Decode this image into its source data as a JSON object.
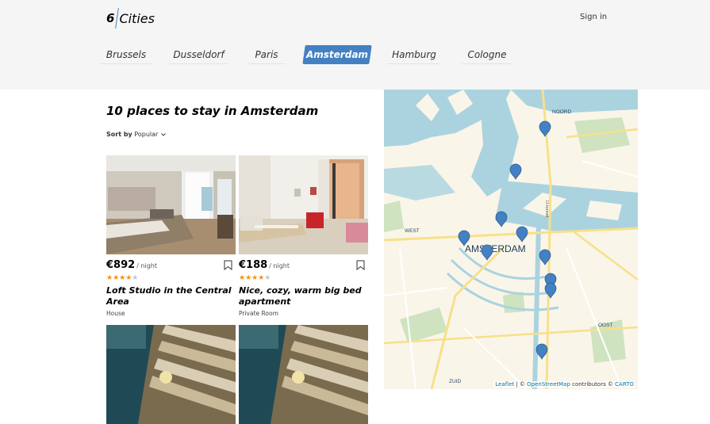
{
  "header": {
    "logo_number": "6",
    "logo_text": "Cities",
    "signin_label": "Sign in"
  },
  "tabs": [
    {
      "label": "Brussels",
      "active": false
    },
    {
      "label": "Dusseldorf",
      "active": false
    },
    {
      "label": "Paris",
      "active": false
    },
    {
      "label": "Amsterdam",
      "active": true
    },
    {
      "label": "Hamburg",
      "active": false
    },
    {
      "label": "Cologne",
      "active": false
    }
  ],
  "main": {
    "title": "10 places to stay in Amsterdam",
    "sort_label": "Sort by",
    "sort_value": "Popular"
  },
  "offers": [
    {
      "price": "€892",
      "per_night": "/ night",
      "rating": 4,
      "name": "Loft Studio in the Central Area",
      "type": "House",
      "bookmark_icon": "bookmark-icon"
    },
    {
      "price": "€188",
      "per_night": "/ night",
      "rating": 4,
      "name": "Nice, cozy, warm big bed apartment",
      "type": "Private Room",
      "bookmark_icon": "bookmark-icon"
    },
    {
      "price": "",
      "per_night": "",
      "rating": 0,
      "name": "",
      "type": ""
    },
    {
      "price": "",
      "per_night": "",
      "rating": 0,
      "name": "",
      "type": ""
    }
  ],
  "map": {
    "labels": {
      "noord": "NOORD",
      "west": "WEST",
      "amsterdam": "AMSTERDAM",
      "oost": "OOST",
      "zuid": "ZUID",
      "street": "IJ-tunnel"
    },
    "attribution": {
      "leaflet": "Leaflet",
      "sep1": " | © ",
      "osm": "OpenStreetMap",
      "mid": " contributors © ",
      "carto": "CARTO"
    },
    "marker_count": 10,
    "marker_icon": "map-pin-icon"
  },
  "colors": {
    "accent": "#4481c3",
    "star": "#ff9000",
    "water": "#aad3df",
    "park": "#cfe3c0"
  }
}
